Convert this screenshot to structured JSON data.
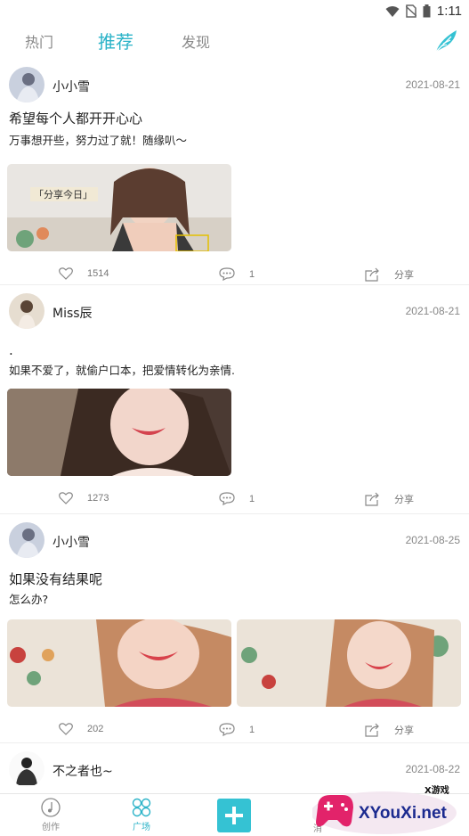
{
  "status_bar": {
    "time": "1:11"
  },
  "top_tabs": [
    {
      "label": "热门"
    },
    {
      "label": "推荐"
    },
    {
      "label": "发现"
    }
  ],
  "posts": [
    {
      "username": "小小雪",
      "date": "2021-08-21",
      "title": "希望每个人都开开心心",
      "body": "万事想开些，努力过了就！随缘叭～",
      "image_caption": "「分享今日」",
      "likes": "1514",
      "comments": "1",
      "share_label": "分享"
    },
    {
      "username": "Miss辰",
      "date": "2021-08-21",
      "title": ".",
      "body": "如果不爱了，就偷户口本，把爱情转化为亲情.",
      "likes": "1273",
      "comments": "1",
      "share_label": "分享"
    },
    {
      "username": "小小雪",
      "date": "2021-08-25",
      "title": "如果没有结果呢",
      "body": "怎么办?",
      "likes": "202",
      "comments": "1",
      "share_label": "分享"
    },
    {
      "username": "不之者也~",
      "date": "2021-08-22"
    }
  ],
  "bottom_nav": {
    "create_label": "创作",
    "square_label": "广场",
    "message_label": "消"
  },
  "watermark": {
    "brand": "XYouXi.net",
    "tag": "X游戏"
  },
  "colors": {
    "accent": "#2bb3c8",
    "plus_button": "#35c2d3"
  }
}
